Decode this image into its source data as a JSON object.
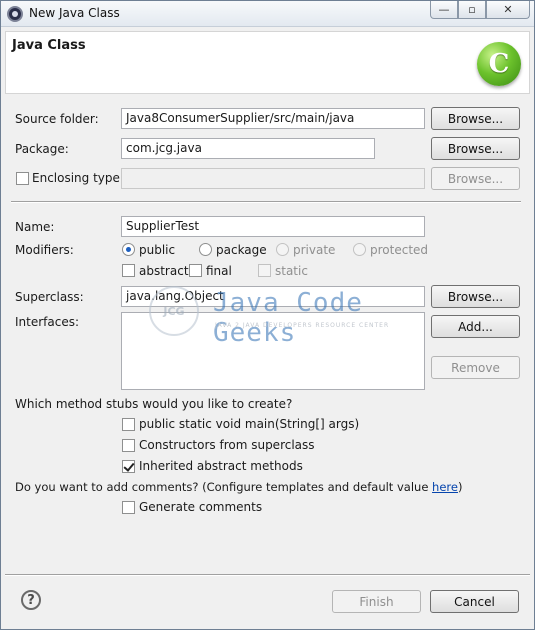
{
  "window": {
    "title": "New Java Class",
    "minimize_glyph": "—",
    "maximize_glyph": "▫",
    "close_glyph": "✕"
  },
  "header": {
    "title": "Java Class",
    "logo_glyph": "C"
  },
  "source_folder": {
    "label": "Source folder:",
    "value": "Java8ConsumerSupplier/src/main/java",
    "browse_label": "Browse..."
  },
  "package": {
    "label": "Package:",
    "value": "com.jcg.java",
    "browse_label": "Browse..."
  },
  "enclosing_type": {
    "label": "Enclosing type:",
    "checked": false,
    "value": "",
    "browse_label": "Browse..."
  },
  "name": {
    "label": "Name:",
    "value": "SupplierTest"
  },
  "modifiers": {
    "label": "Modifiers:",
    "public": "public",
    "package": "package",
    "private": "private",
    "protected": "protected",
    "abstract": "abstract",
    "final": "final",
    "static": "static",
    "selected": "public"
  },
  "superclass": {
    "label": "Superclass:",
    "value": "java.lang.Object",
    "browse_label": "Browse..."
  },
  "interfaces": {
    "label": "Interfaces:",
    "add_label": "Add...",
    "remove_label": "Remove"
  },
  "watermark": {
    "circle_text": "JCG",
    "title": "Java Code Geeks",
    "subtitle": "JAVA 2 JAVA DEVELOPERS RESOURCE CENTER"
  },
  "method_stubs": {
    "question": "Which method stubs would you like to create?",
    "main": "public static void main(String[] args)",
    "constructors": "Constructors from superclass",
    "inherited": "Inherited abstract methods",
    "inherited_checked": true
  },
  "comments": {
    "question": "Do you want to add comments? (Configure templates and default value ",
    "link": "here",
    "question_end": ")",
    "generate": "Generate comments"
  },
  "footer": {
    "help_glyph": "?",
    "finish_label": "Finish",
    "cancel_label": "Cancel"
  },
  "colors": {
    "logo_green": "#6cc22c",
    "watermark_blue": "#2f6fb3",
    "link_blue": "#0645ad"
  }
}
